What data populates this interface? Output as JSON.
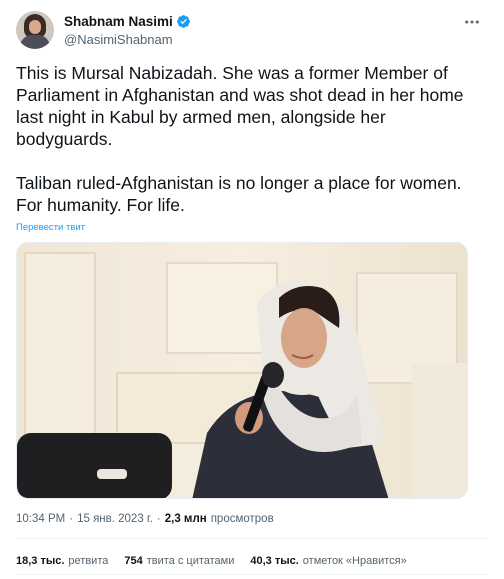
{
  "author": {
    "name": "Shabnam Nasimi",
    "handle": "@NasimiShabnam",
    "verified": true
  },
  "tweet": {
    "text": "This is Mursal Nabizadah. She was a former Member of Parliament in Afghanistan and was shot dead in her home last night in Kabul by armed men, alongside her bodyguards.\n\nTaliban ruled-Afghanistan is no longer a place for women. For humanity. For life.",
    "translate_link": "Перевести твит"
  },
  "meta": {
    "time": "10:34 PM",
    "separator": "·",
    "date": "15 янв. 2023 г.",
    "views_count": "2,3 млн",
    "views_label": "просмотров"
  },
  "stats": {
    "retweets_count": "18,3 тыс.",
    "retweets_label": "ретвита",
    "quotes_count": "754",
    "quotes_label": "твита с цитатами",
    "likes_count": "40,3 тыс.",
    "likes_label": "отметок «Нравится»"
  },
  "colors": {
    "link": "#1d9bf0",
    "verified": "#1d9bf0",
    "text": "#0f1419",
    "secondary": "#536471"
  },
  "icons": {
    "more": "more-horizontal-icon",
    "verified": "verified-badge-icon"
  }
}
